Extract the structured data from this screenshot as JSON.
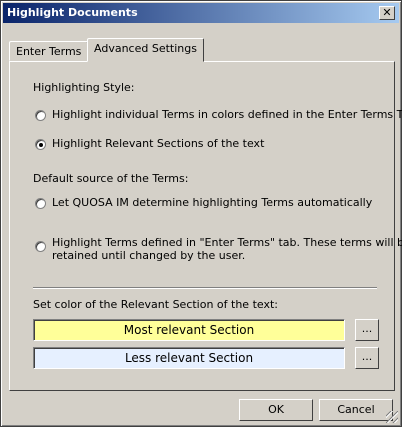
{
  "window": {
    "title": "Highlight Documents",
    "close_glyph": "✕"
  },
  "tabs": [
    {
      "label": "Enter Terms",
      "selected": false
    },
    {
      "label": "Advanced Settings",
      "selected": true
    }
  ],
  "highlighting_style": {
    "heading": "Highlighting Style:",
    "options": [
      {
        "label": "Highlight individual Terms in colors defined in the Enter Terms Tab",
        "checked": false
      },
      {
        "label": "Highlight Relevant Sections of the text",
        "checked": true
      }
    ]
  },
  "default_source": {
    "heading": "Default source of the Terms:",
    "options": [
      {
        "label": "Let QUOSA IM determine highlighting Terms automatically",
        "checked": false
      },
      {
        "line1": "Highlight Terms defined in \"Enter Terms\" tab. These terms will be",
        "line2": "retained until changed by the user.",
        "checked": false
      }
    ]
  },
  "color_section": {
    "heading": "Set color of the Relevant Section of the text:",
    "most": {
      "label": "Most relevant Section",
      "color": "#ffff99",
      "button": "..."
    },
    "less": {
      "label": "Less relevant Section",
      "color": "#e6f0ff",
      "button": "..."
    }
  },
  "buttons": {
    "ok": "OK",
    "cancel": "Cancel"
  }
}
